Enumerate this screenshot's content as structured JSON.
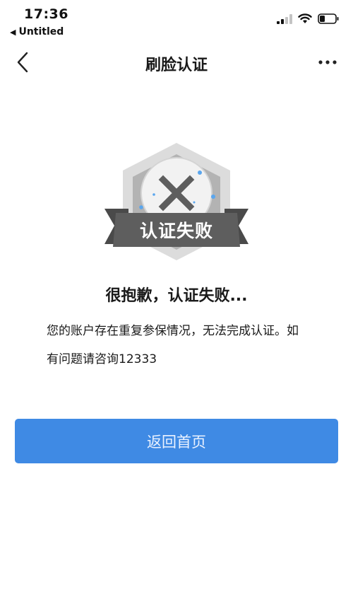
{
  "status_bar": {
    "time": "17:36",
    "back_app_label": "Untitled"
  },
  "nav": {
    "title": "刷脸认证"
  },
  "badge": {
    "label": "认证失败"
  },
  "message": {
    "heading": "很抱歉，认证失败...",
    "description": "您的账户存在重复参保情况，无法完成认证。如有问题请咨询12333"
  },
  "button": {
    "label": "返回首页"
  },
  "colors": {
    "accent": "#3f8ae4",
    "badge_ribbon": "#5e5e5e",
    "badge_hex_outer": "#d9d9d9",
    "badge_hex_inner": "#b5b5b5"
  }
}
